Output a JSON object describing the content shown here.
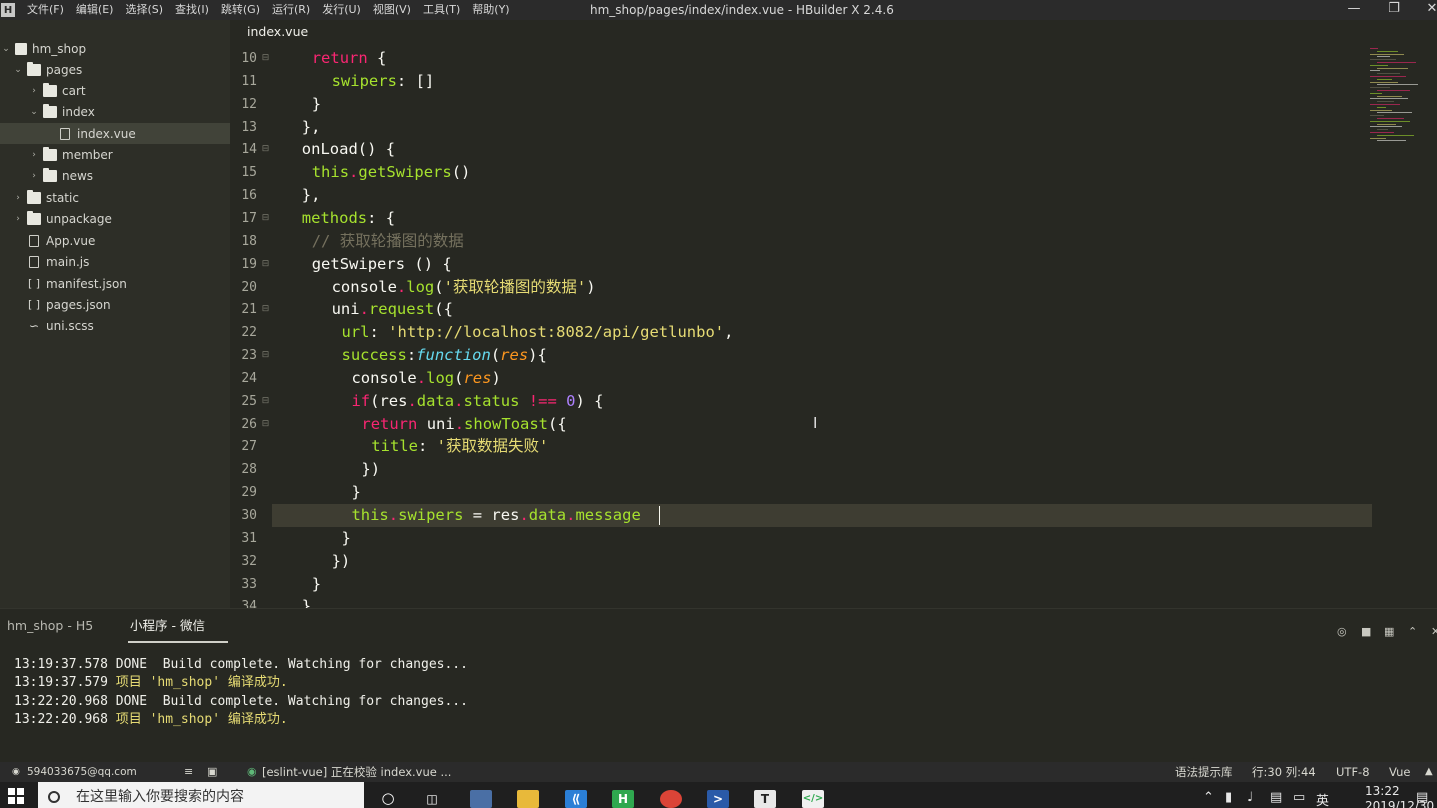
{
  "menubar": {
    "logo": "H",
    "items": [
      "文件(F)",
      "编辑(E)",
      "选择(S)",
      "查找(I)",
      "跳转(G)",
      "运行(R)",
      "发行(U)",
      "视图(V)",
      "工具(T)",
      "帮助(Y)"
    ],
    "title": "hm_shop/pages/index/index.vue - HBuilder X 2.4.6"
  },
  "sidebar": {
    "items": [
      {
        "label": "hm_shop"
      },
      {
        "label": "pages"
      },
      {
        "label": "cart"
      },
      {
        "label": "index"
      },
      {
        "label": "index.vue"
      },
      {
        "label": "member"
      },
      {
        "label": "news"
      },
      {
        "label": "static"
      },
      {
        "label": "unpackage"
      },
      {
        "label": "App.vue"
      },
      {
        "label": "main.js"
      },
      {
        "label": "manifest.json"
      },
      {
        "label": "pages.json"
      },
      {
        "label": "uni.scss"
      }
    ]
  },
  "editor": {
    "tab": "index.vue",
    "lines": [
      {
        "n": "10",
        "text": "return {"
      },
      {
        "n": "11",
        "text": "swipers: []"
      },
      {
        "n": "12",
        "text": "}"
      },
      {
        "n": "13",
        "text": "},"
      },
      {
        "n": "14",
        "text": "onLoad() {"
      },
      {
        "n": "15",
        "text": "this.getSwipers()"
      },
      {
        "n": "16",
        "text": "},"
      },
      {
        "n": "17",
        "text": "methods: {"
      },
      {
        "n": "18",
        "text": "// 获取轮播图的数据"
      },
      {
        "n": "19",
        "text": "getSwipers () {"
      },
      {
        "n": "20",
        "text": "console.log('获取轮播图的数据')"
      },
      {
        "n": "21",
        "text": "uni.request({"
      },
      {
        "n": "22",
        "text": "url: 'http://localhost:8082/api/getlunbo',"
      },
      {
        "n": "23",
        "text": "success:function(res){"
      },
      {
        "n": "24",
        "text": "console.log(res)"
      },
      {
        "n": "25",
        "text": "if(res.data.status !== 0) {"
      },
      {
        "n": "26",
        "text": "return uni.showToast({"
      },
      {
        "n": "27",
        "text": "title: '获取数据失败'"
      },
      {
        "n": "28",
        "text": "})"
      },
      {
        "n": "29",
        "text": "}"
      },
      {
        "n": "30",
        "text": "this.swipers = res.data.message"
      },
      {
        "n": "31",
        "text": "}"
      },
      {
        "n": "32",
        "text": "})"
      },
      {
        "n": "33",
        "text": "}"
      },
      {
        "n": "34",
        "text": "},"
      }
    ]
  },
  "console": {
    "tabs": [
      "hm_shop - H5",
      "小程序 - 微信"
    ],
    "logs": [
      {
        "time": "13:19:37.578",
        "msg": " DONE  Build complete. Watching for changes..."
      },
      {
        "time": "13:19:37.579",
        "msg": " 项目 'hm_shop' 编译成功."
      },
      {
        "time": "13:22:20.968",
        "msg": " DONE  Build complete. Watching for changes..."
      },
      {
        "time": "13:22:20.968",
        "msg": " 项目 'hm_shop' 编译成功."
      }
    ]
  },
  "statusbar": {
    "account": "594033675@qq.com",
    "lint": "[eslint-vue] 正在校验 index.vue ...",
    "hint": "语法提示库",
    "position": "行:30  列:44",
    "encoding": "UTF-8",
    "language": "Vue"
  },
  "taskbar": {
    "search_placeholder": "在这里输入你要搜索的内容",
    "ime": "英",
    "time": "13:22",
    "date": "2019/12/30"
  },
  "colors": {
    "editor_bg": "#272822",
    "sidebar_bg": "#2d2e27",
    "keyword": "#f92672",
    "function": "#a6e22e",
    "string": "#e6db74",
    "number": "#ae81ff",
    "comment": "#75715e"
  }
}
